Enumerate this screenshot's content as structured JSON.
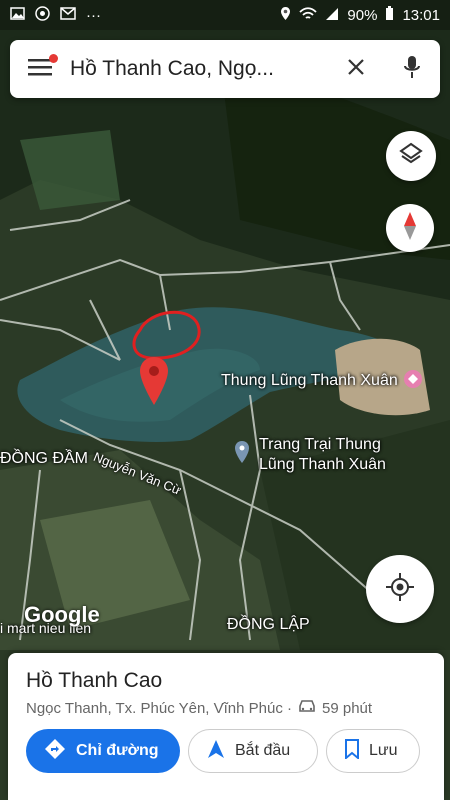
{
  "status": {
    "battery": "90%",
    "time": "13:01"
  },
  "search": {
    "query": "Hồ Thanh Cao, Ngọ..."
  },
  "map": {
    "labels": {
      "thung_lung": "Thung Lũng Thanh Xuân",
      "trang_trai_line1": "Trang Trại Thung",
      "trang_trai_line2": "Lũng Thanh Xuân",
      "dong_dam": "ĐỒNG ĐẦM",
      "nguyen_van_cu": "Nguyễn Văn Cừ",
      "dong_lap": "ĐỒNG LẬP",
      "mart": "i mart nieu lien"
    },
    "google": "Google"
  },
  "place": {
    "name": "Hồ Thanh Cao",
    "address": "Ngọc Thanh, Tx. Phúc Yên, Vĩnh Phúc ·",
    "drive_time": "59 phút"
  },
  "actions": {
    "directions": "Chỉ đường",
    "start": "Bắt đầu",
    "save": "Lưu"
  },
  "colors": {
    "accent": "#1a73e8",
    "pin": "#e53935"
  }
}
